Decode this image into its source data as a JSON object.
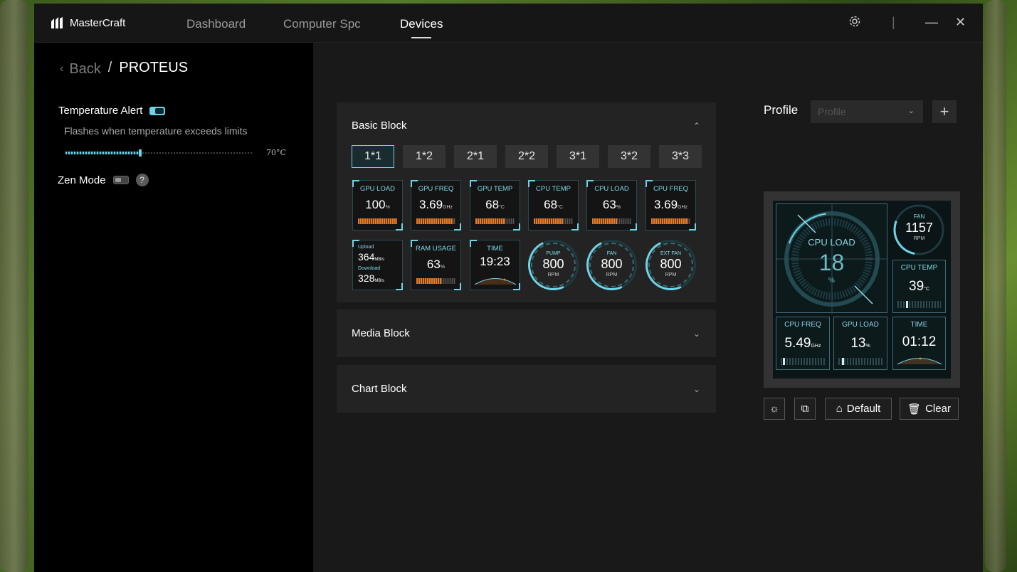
{
  "app": {
    "name": "MasterCraft"
  },
  "nav": {
    "tabs": [
      "Dashboard",
      "Computer Spc",
      "Devices"
    ],
    "active": "Devices"
  },
  "breadcrumb": {
    "back": "Back",
    "separator": "/",
    "title": "PROTEUS"
  },
  "settings": {
    "temperature_alert": {
      "label": "Temperature Alert",
      "enabled": true,
      "description": "Flashes when temperature exceeds limits",
      "value": "70°C",
      "fraction": 0.4
    },
    "zen_mode": {
      "label": "Zen Mode",
      "enabled": false,
      "help": "?"
    }
  },
  "basic_block": {
    "title": "Basic Block",
    "sizes": [
      "1*1",
      "1*2",
      "2*1",
      "2*2",
      "3*1",
      "3*2",
      "3*3"
    ],
    "selected_size": "1*1",
    "row1": [
      {
        "label": "GPU LOAD",
        "value": "100",
        "unit": "%",
        "level": 1.0
      },
      {
        "label": "GPU FREQ",
        "value": "3.69",
        "unit": "GHz",
        "level": 0.95
      },
      {
        "label": "GPU TEMP",
        "value": "68",
        "unit": "°C",
        "level": 0.75
      },
      {
        "label": "CPU TEMP",
        "value": "68",
        "unit": "°C",
        "level": 0.75
      },
      {
        "label": "CPU LOAD",
        "value": "63",
        "unit": "%",
        "level": 0.63
      },
      {
        "label": "CPU FREQ",
        "value": "3.69",
        "unit": "GHz",
        "level": 0.95
      }
    ],
    "network": {
      "upload_label": "Upload",
      "upload": "364",
      "download_label": "Download",
      "download": "328",
      "unit": "MB/s"
    },
    "ram": {
      "label": "RAM USAGE",
      "value": "63",
      "unit": "%",
      "level": 0.63
    },
    "time": {
      "label": "TIME",
      "value": "19:23"
    },
    "gauges": [
      {
        "label": "PUMP",
        "value": "800",
        "unit": "RPM"
      },
      {
        "label": "FAN",
        "value": "800",
        "unit": "RPM"
      },
      {
        "label": "EXT FAN",
        "value": "800",
        "unit": "RPM"
      }
    ]
  },
  "media_block": {
    "title": "Media Block"
  },
  "chart_block": {
    "title": "Chart Block"
  },
  "profile": {
    "label": "Profile",
    "placeholder": "Profile",
    "add": "+"
  },
  "preview": {
    "cpu_load": {
      "label": "CPU LOAD",
      "value": "18",
      "unit": "%"
    },
    "fan": {
      "label": "FAN",
      "value": "1157",
      "unit": "RPM"
    },
    "cpu_temp": {
      "label": "CPU TEMP",
      "value": "39",
      "unit": "°C"
    },
    "cpu_freq": {
      "label": "CPU FREQ",
      "value": "5.49",
      "unit": "GHz"
    },
    "gpu_load": {
      "label": "GPU LOAD",
      "value": "13",
      "unit": "%"
    },
    "time": {
      "label": "TIME",
      "value": "01:12"
    }
  },
  "actions": {
    "default": "Default",
    "clear": "Clear"
  },
  "colors": {
    "accent": "#6fd3e6",
    "warning": "#e37a2a",
    "panel": "#232323"
  }
}
